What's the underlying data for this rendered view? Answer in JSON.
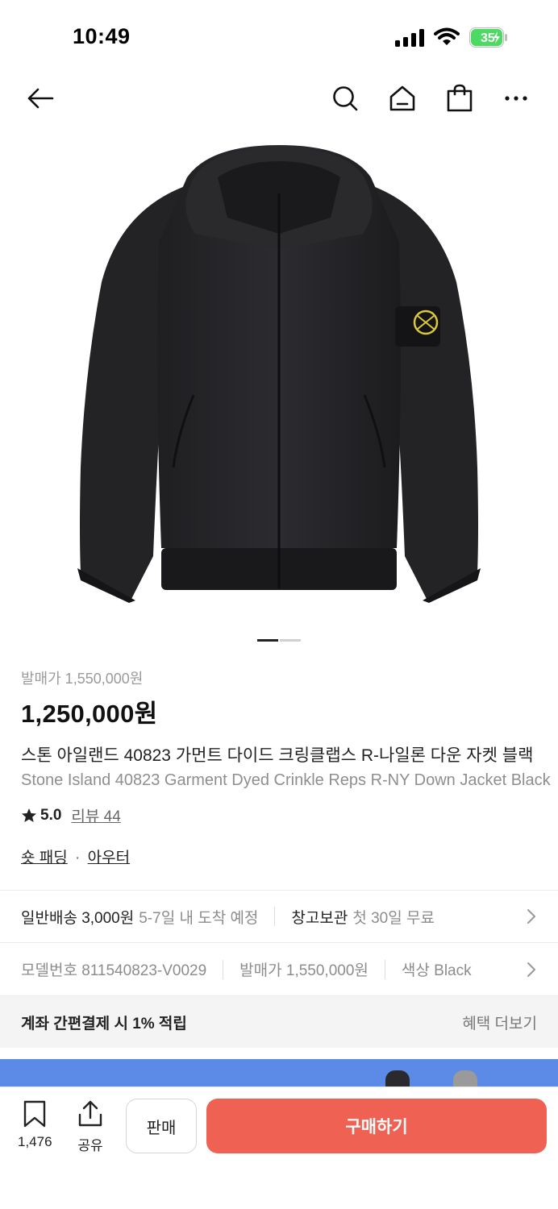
{
  "status_bar": {
    "time": "10:49",
    "battery": "35"
  },
  "nav": {
    "icons": [
      "back-arrow-icon",
      "search-icon",
      "home-icon",
      "shopping-bag-icon",
      "more-icon"
    ]
  },
  "product": {
    "image_alt": "Black hooded down jacket",
    "carousel": {
      "current": 1,
      "total": 2
    },
    "release_price_label": "발매가 1,550,000원",
    "price": "1,250,000원",
    "title_ko": "스톤 아일랜드 40823 가먼트 다이드 크링클랩스 R-나일론 다운 자켓 블랙",
    "title_en": "Stone Island 40823 Garment Dyed Crinkle Reps R-NY Down Jacket Black",
    "rating": "5.0",
    "review_label": "리뷰 44",
    "categories": [
      "숏 패딩",
      "아우터"
    ],
    "category_separator": "·"
  },
  "delivery": {
    "standard_label": "일반배송 3,000원",
    "standard_eta": "5-7일 내 도착 예정",
    "warehouse_label": "창고보관",
    "warehouse_note": "첫 30일 무료"
  },
  "specs": {
    "model": "모델번호 811540823-V0029",
    "release_price": "발매가 1,550,000원",
    "color": "색상 Black"
  },
  "benefit": {
    "text": "계좌 간편결제 시 1% 적립",
    "more_label": "혜택 더보기"
  },
  "bottom_bar": {
    "wishlist_count": "1,476",
    "share_label": "공유",
    "sell_label": "판매",
    "buy_label": "구매하기"
  },
  "colors": {
    "accent": "#ef6253",
    "banner": "#5b8be6",
    "muted": "#8c8c8c"
  }
}
